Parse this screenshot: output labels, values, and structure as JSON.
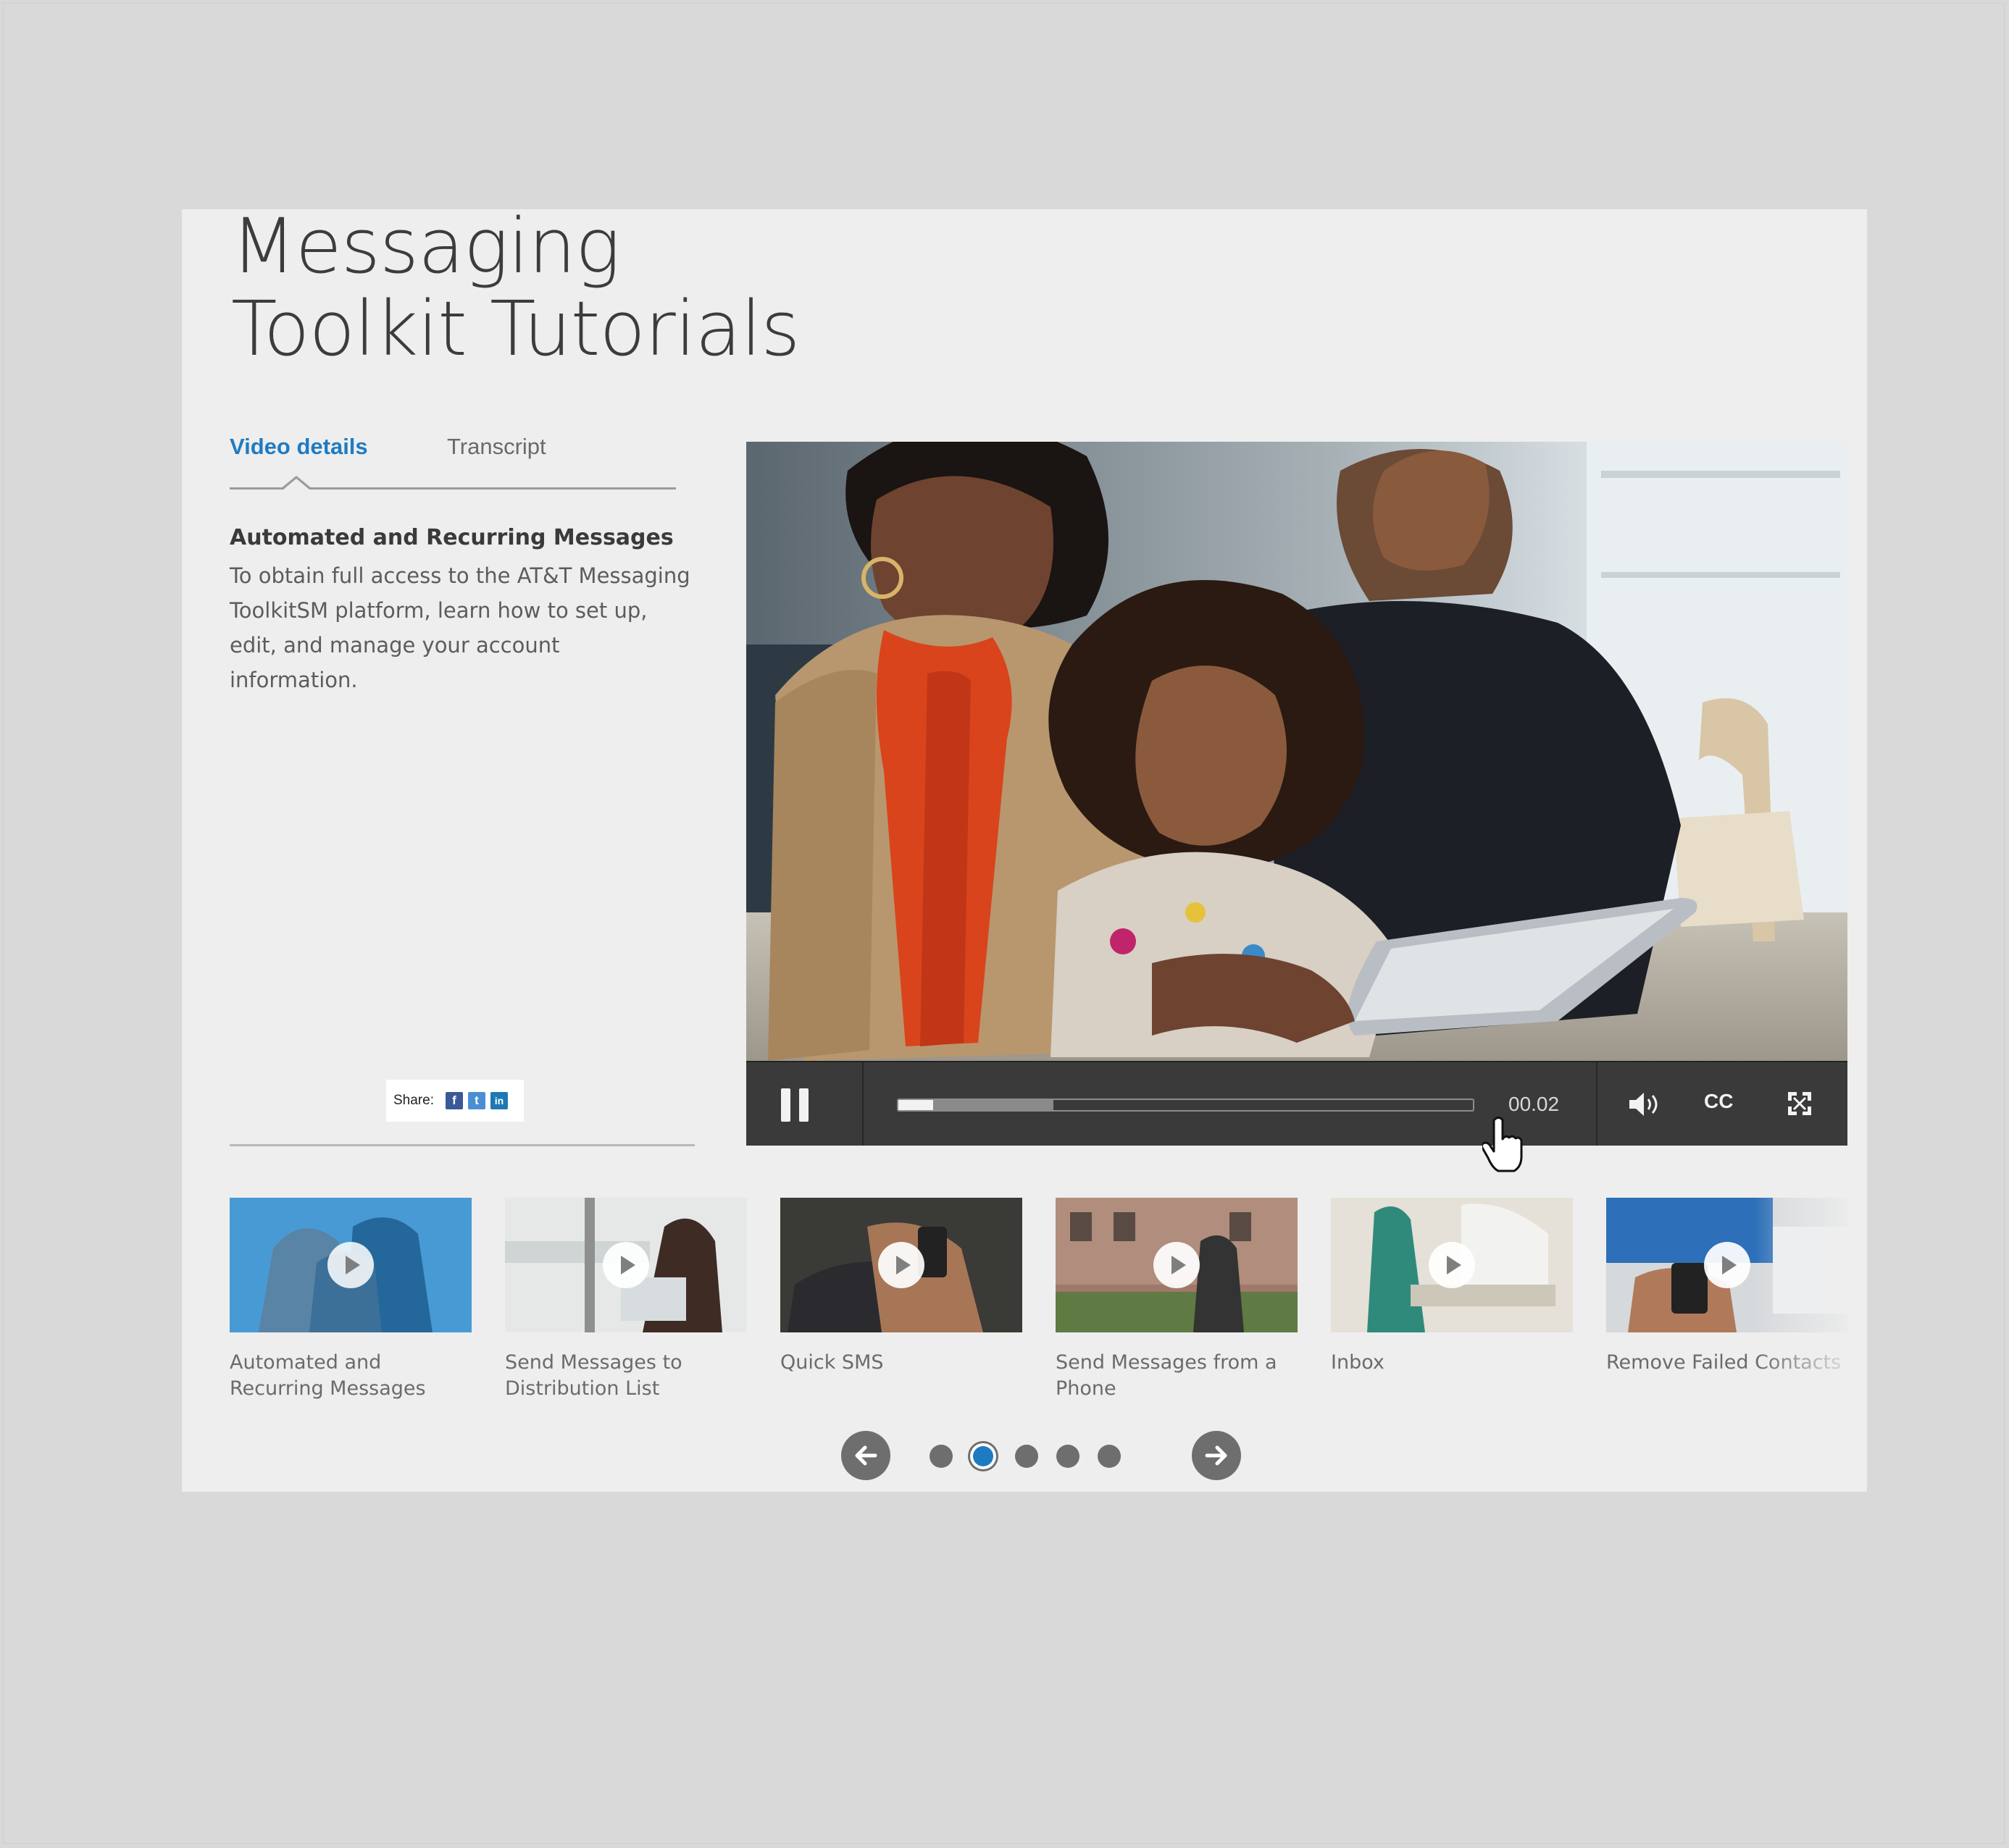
{
  "page": {
    "title_line1": "Messaging",
    "title_line2": "Toolkit Tutorials"
  },
  "tabs": [
    {
      "label": "Video details",
      "active": true
    },
    {
      "label": "Transcript",
      "active": false
    }
  ],
  "video_details": {
    "heading": "Automated and Recurring Messages",
    "body": "To obtain full access to the AT&T Messaging ToolkitSM platform, learn how to set up, edit, and manage your account information."
  },
  "share": {
    "label": "Share:",
    "icons": [
      "facebook-icon",
      "twitter-icon",
      "linkedin-icon"
    ],
    "fb_glyph": "f",
    "tw_glyph": "t",
    "li_glyph": "in"
  },
  "player": {
    "time": "00.02",
    "cc_label": "CC",
    "played_fraction": 0.06,
    "buffered_fraction": 0.27,
    "state": "playing"
  },
  "thumbnails": [
    {
      "title": "Automated and\nRecurring Messages",
      "active": true
    },
    {
      "title": "Send Messages to\nDistribution List",
      "active": false
    },
    {
      "title": "Quick SMS",
      "active": false
    },
    {
      "title": "Send Messages from a\nPhone",
      "active": false
    },
    {
      "title": "Inbox",
      "active": false
    },
    {
      "title": "Remove Failed Contacts",
      "active": false
    }
  ],
  "pagination": {
    "page_count": 5,
    "current_page": 2
  },
  "colors": {
    "accent": "#1f7bc1",
    "panel_bg": "#eeeeee",
    "page_bg": "#d9d9d9",
    "control_bar": "#3a3a3a"
  }
}
